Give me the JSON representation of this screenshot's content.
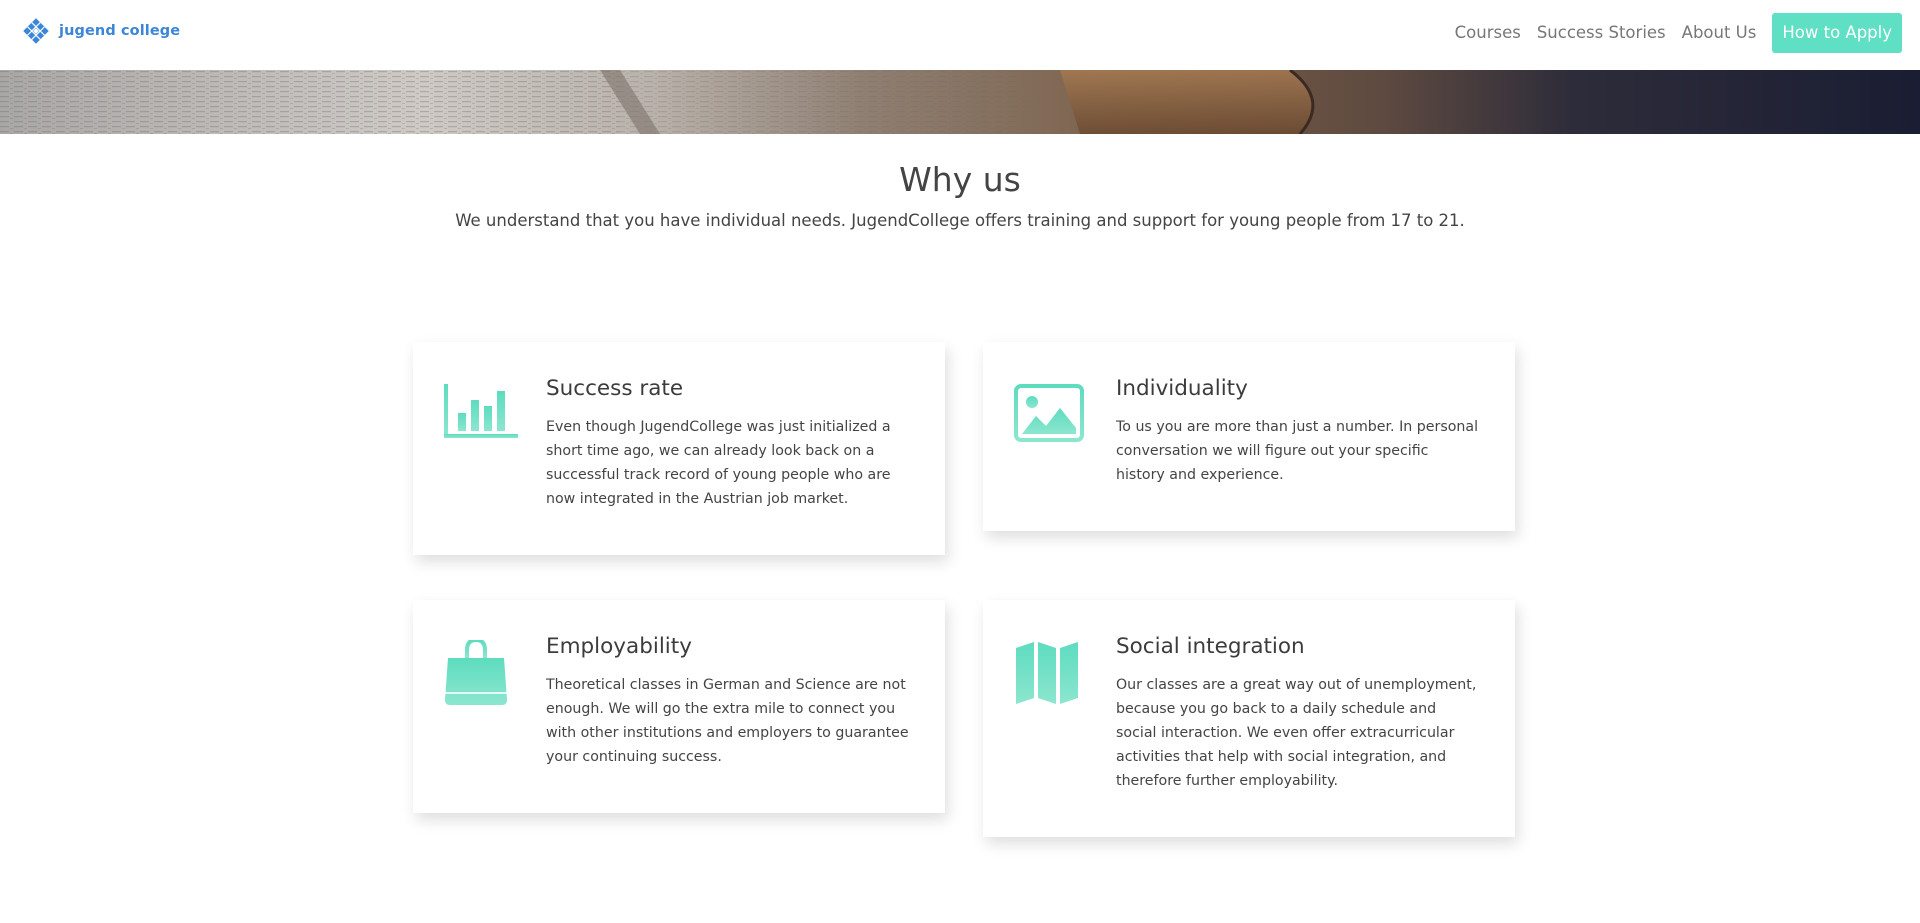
{
  "header": {
    "brand": "jugend college",
    "nav": [
      {
        "label": "Courses"
      },
      {
        "label": "Success Stories"
      },
      {
        "label": "About Us"
      }
    ],
    "cta": "How to Apply"
  },
  "why_us": {
    "title": "Why us",
    "subtitle": "We understand that you have individual needs. JugendCollege offers training and support for young people from 17 to 21."
  },
  "features": [
    {
      "icon": "bar-chart-icon",
      "title": "Success rate",
      "text": "Even though JugendCollege was just initialized a short time ago, we can already look back on a successful track record of young people who are now integrated in the Austrian job market."
    },
    {
      "icon": "image-icon",
      "title": "Individuality",
      "text": "To us you are more than just a number. In personal conversation we will figure out your specific history and experience."
    },
    {
      "icon": "shopping-bag-icon",
      "title": "Employability",
      "text": "Theoretical classes in German and Science are not enough. We will go the extra mile to connect you with other institutions and employers to guarantee your continuing success."
    },
    {
      "icon": "map-icon",
      "title": "Social integration",
      "text": "Our classes are a great way out of unemployment, because you go back to a daily schedule and social interaction. We even offer extracurricular activities that help with social integration, and therefore further employability."
    }
  ],
  "colors": {
    "brand": "#3b86d8",
    "accent": "#5fdfc4",
    "accent_gradient_top": "#5ddcbf",
    "accent_gradient_bottom": "#8ce6cf"
  }
}
